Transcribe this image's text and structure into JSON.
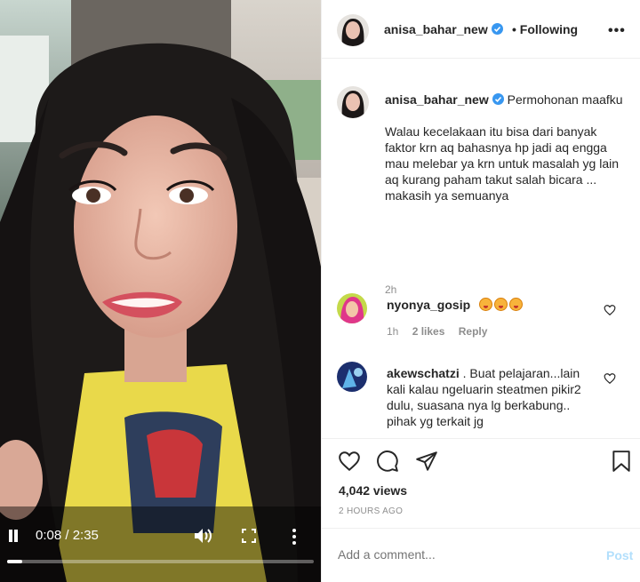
{
  "video": {
    "time": "0:08 / 2:35",
    "progress_fraction": 0.05
  },
  "header": {
    "username": "anisa_bahar_new",
    "follow_status": "• Following",
    "more": "•••"
  },
  "caption": {
    "username": "anisa_bahar_new",
    "lead": "Permohonan maafku",
    "body": "Walau kecelakaan itu bisa dari banyak faktor krn aq bahasnya hp jadi aq engga mau melebar ya krn untuk masalah yg lain aq kurang paham takut salah bicara ... makasih ya semuanya",
    "time": "2h"
  },
  "comments": [
    {
      "username": "nyonya_gosip",
      "text": "",
      "emoji_count": 3,
      "time": "1h",
      "likes": "2 likes",
      "reply": "Reply"
    },
    {
      "username": "akewschatzi",
      "text": ". Buat pelajaran...lain kali kalau ngeluarin steatmen pikir2 dulu, suasana nya lg berkabung.. pihak yg terkait jg"
    }
  ],
  "actions": {
    "views": "4,042 views",
    "posted": "2 HOURS AGO"
  },
  "add_comment": {
    "placeholder": "Add a comment...",
    "post_label": "Post"
  },
  "colors": {
    "verified": "#3897f0",
    "muted": "#8e8e8e",
    "post_disabled": "#b2dffc"
  }
}
